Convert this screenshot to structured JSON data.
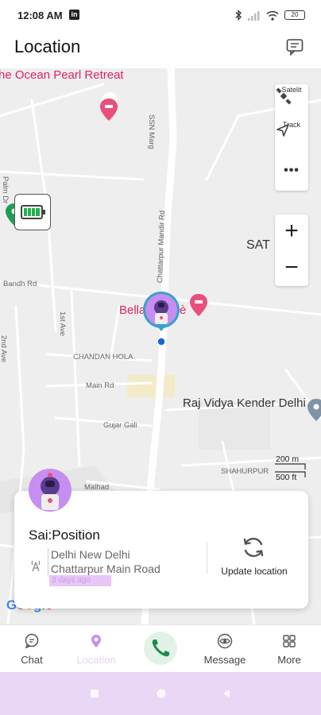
{
  "status_bar": {
    "time": "12:08 AM",
    "linkedin_icon": "linkedin-icon",
    "battery_text": "20"
  },
  "header": {
    "title": "Location",
    "message_icon": "chat-bubble-icon"
  },
  "map": {
    "labels": {
      "ocean_pearl": "he Ocean Pearl Retreat",
      "ssn_marg": "SSN Marg",
      "chattarpur_mandir": "Chattarpur Mandir Rd",
      "palm_dr": "Palm Dr",
      "bandh_rd": "Bandh Rd",
      "first_ave": "1st Ave",
      "second_ave": "2nd Ave",
      "chandan_hola": "CHANDAN HOLA",
      "main_rd": "Main Rd",
      "gujar_gali": "Gujar Gali",
      "malhad": "Malhad",
      "shahurpur": "SHAHURPUR",
      "bella_left": "Bella",
      "bella_right": "è",
      "raj_vidya": "Raj Vidya Kender Delhi",
      "sat": "SAT",
      "scale_m": "200 m",
      "scale_ft": "500 ft",
      "google": "Google"
    },
    "controls": {
      "satellite_label": "Satelit",
      "track_label": "Track",
      "more_label": "•••",
      "zoom_in": "+",
      "zoom_out": "−"
    },
    "battery_level": 1.0,
    "colors": {
      "poi_red": "#e0245e",
      "water_blue": "#9bc1f1",
      "park_green": "#1f9d55",
      "avatar_purple": "#c68ef0",
      "location_dot": "#1a66d6"
    }
  },
  "card": {
    "name": "Sai:Position",
    "address_line1": "Delhi New Delhi",
    "address_line2": "Chattarpur Main Road",
    "timestamp": "3 days ago",
    "update_label": "Update location"
  },
  "nav": {
    "items": [
      {
        "label": "Chat",
        "icon": "chat-icon"
      },
      {
        "label": "Location",
        "icon": "location-pin-icon",
        "active": true
      },
      {
        "label": "",
        "icon": "phone-icon"
      },
      {
        "label": "Message",
        "icon": "eye-icon"
      },
      {
        "label": "More",
        "icon": "grid-icon"
      }
    ]
  }
}
